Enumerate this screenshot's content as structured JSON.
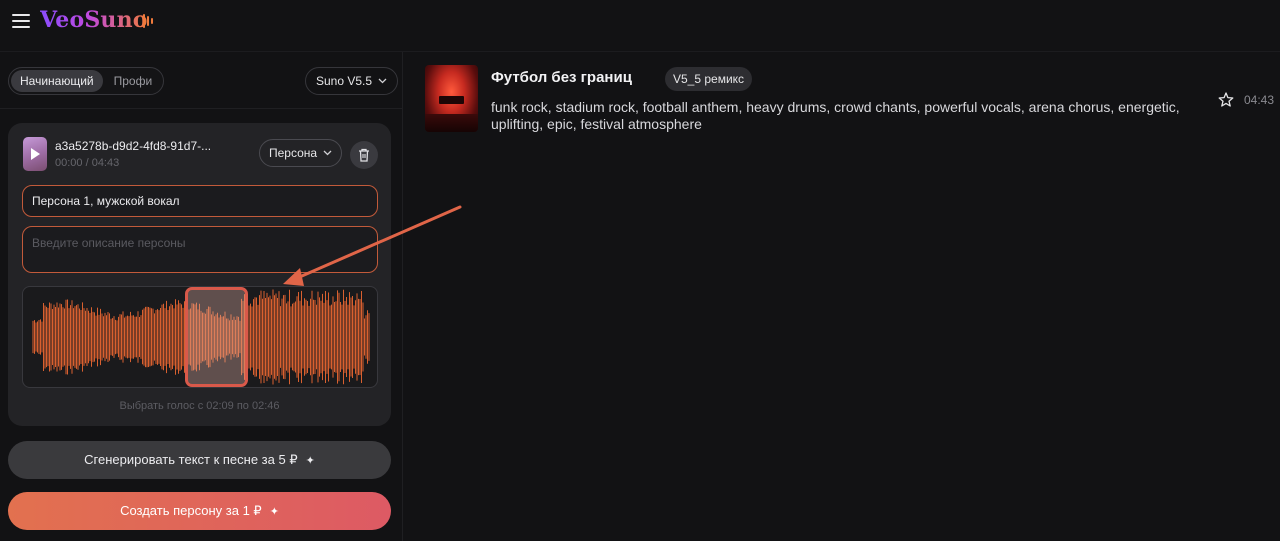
{
  "app": {
    "logo_text": "VeoSuno"
  },
  "left_panel": {
    "modes": [
      {
        "label": "Начинающий",
        "active": true
      },
      {
        "label": "Профи",
        "active": false
      }
    ],
    "model_label": "Suno V5.5",
    "track": {
      "name": "a3a5278b-d9d2-4fd8-91d7-...",
      "time": "00:00 / 04:43"
    },
    "persona_button_label": "Персона",
    "persona_name_value": "Персона 1, мужской вокал",
    "persona_description_placeholder": "Введите описание персоны",
    "voice_selection_caption": "Выбрать голос с 02:09 по 02:46",
    "generate_text_button": "Сгенерировать текст к песне за 5 ₽",
    "create_persona_button": "Создать персону за 1 ₽"
  },
  "song": {
    "title": "Футбол без границ",
    "badge": "V5_5 ремикс",
    "tags": "funk rock, stadium rock, football anthem, heavy drums, crowd chants, powerful vocals, arena chorus, energetic, uplifting, epic, festival atmosphere",
    "duration": "04:43"
  },
  "colors": {
    "accent_orange": "#e2714f",
    "accent_pink": "#dd5a64",
    "waveform": "#d9602f",
    "selection_border": "#d9594a",
    "input_border": "#c25a3a"
  },
  "icons": {
    "menu": "hamburger-icon",
    "play": "play-icon",
    "chevron": "chevron-down-icon",
    "trash": "trash-icon",
    "sparkle": "sparkle-icon",
    "star": "star-icon"
  }
}
